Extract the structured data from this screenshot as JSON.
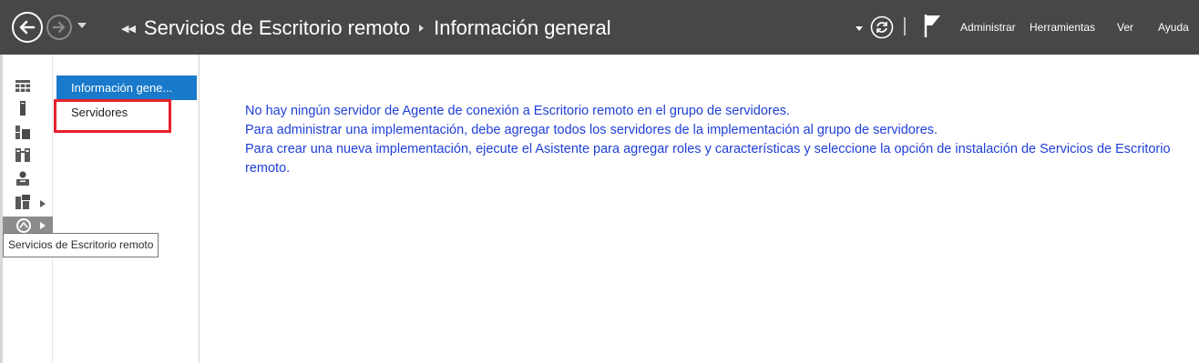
{
  "breadcrumb": {
    "parent": "Servicios de Escritorio remoto",
    "current": "Información general"
  },
  "menu": {
    "manage": "Administrar",
    "tools": "Herramientas",
    "view": "Ver",
    "help": "Ayuda"
  },
  "subnav": {
    "items": [
      {
        "label": "Información gene...",
        "selected": true
      },
      {
        "label": "Servidores",
        "selected": false
      }
    ]
  },
  "tooltip": "Servicios de Escritorio remoto",
  "main": {
    "messages": [
      "No hay ningún servidor de Agente de conexión a Escritorio remoto en el grupo de servidores.",
      "Para administrar una implementación, debe agregar todos los servidores de la implementación al grupo de servidores.",
      "Para crear una nueva implementación, ejecute el Asistente para agregar roles y características y seleccione la opción de instalación de Servicios de Escritorio remoto."
    ]
  },
  "icons": {
    "back": "back-arrow-icon",
    "forward": "forward-arrow-icon",
    "refresh": "refresh-icon",
    "notifications": "flag-icon",
    "rail": [
      "dashboard-icon",
      "local-server-icon",
      "all-servers-icon",
      "file-storage-icon",
      "users-icon",
      "roles-icon",
      "remote-desktop-icon"
    ]
  },
  "colors": {
    "titlebar": "#474747",
    "selection": "#1979ca",
    "message_text": "#1f3fd6",
    "highlight": "#e8212c"
  }
}
